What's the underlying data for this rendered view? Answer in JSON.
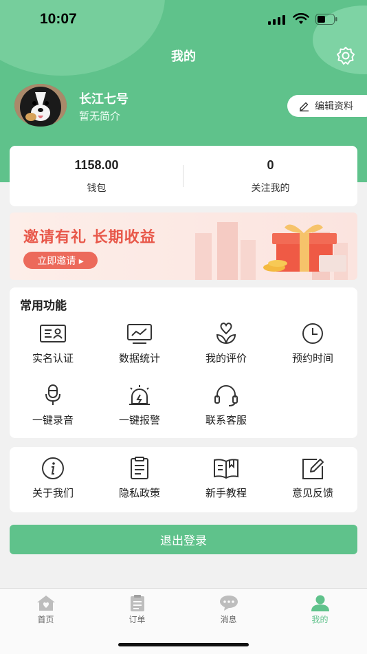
{
  "status": {
    "time": "10:07"
  },
  "header": {
    "title": "我的"
  },
  "profile": {
    "name": "长江七号",
    "bio": "暂无简介",
    "edit_label": "编辑资料"
  },
  "stats": [
    {
      "value": "1158.00",
      "label": "钱包"
    },
    {
      "value": "0",
      "label": "关注我的"
    }
  ],
  "banner": {
    "title": "邀请有礼  长期收益",
    "button": "立即邀请 ▸"
  },
  "common": {
    "title": "常用功能",
    "items": [
      {
        "label": "实名认证",
        "icon": "id-card-icon"
      },
      {
        "label": "数据统计",
        "icon": "chart-monitor-icon"
      },
      {
        "label": "我的评价",
        "icon": "flower-heart-icon"
      },
      {
        "label": "预约时间",
        "icon": "clock-icon"
      },
      {
        "label": "一键录音",
        "icon": "microphone-icon"
      },
      {
        "label": "一键报警",
        "icon": "alarm-icon"
      },
      {
        "label": "联系客服",
        "icon": "headset-icon"
      }
    ]
  },
  "more": {
    "items": [
      {
        "label": "关于我们",
        "icon": "info-icon"
      },
      {
        "label": "隐私政策",
        "icon": "clipboard-icon"
      },
      {
        "label": "新手教程",
        "icon": "book-icon"
      },
      {
        "label": "意见反馈",
        "icon": "edit-icon"
      }
    ]
  },
  "logout": {
    "label": "退出登录"
  },
  "tabbar": {
    "items": [
      {
        "label": "首页",
        "icon": "home-icon",
        "active": false
      },
      {
        "label": "订单",
        "icon": "order-icon",
        "active": false
      },
      {
        "label": "消息",
        "icon": "message-icon",
        "active": false
      },
      {
        "label": "我的",
        "icon": "user-icon",
        "active": true
      }
    ]
  },
  "colors": {
    "primary": "#5fc28b",
    "banner_text": "#e8584a",
    "banner_button": "#ec6a5b"
  }
}
